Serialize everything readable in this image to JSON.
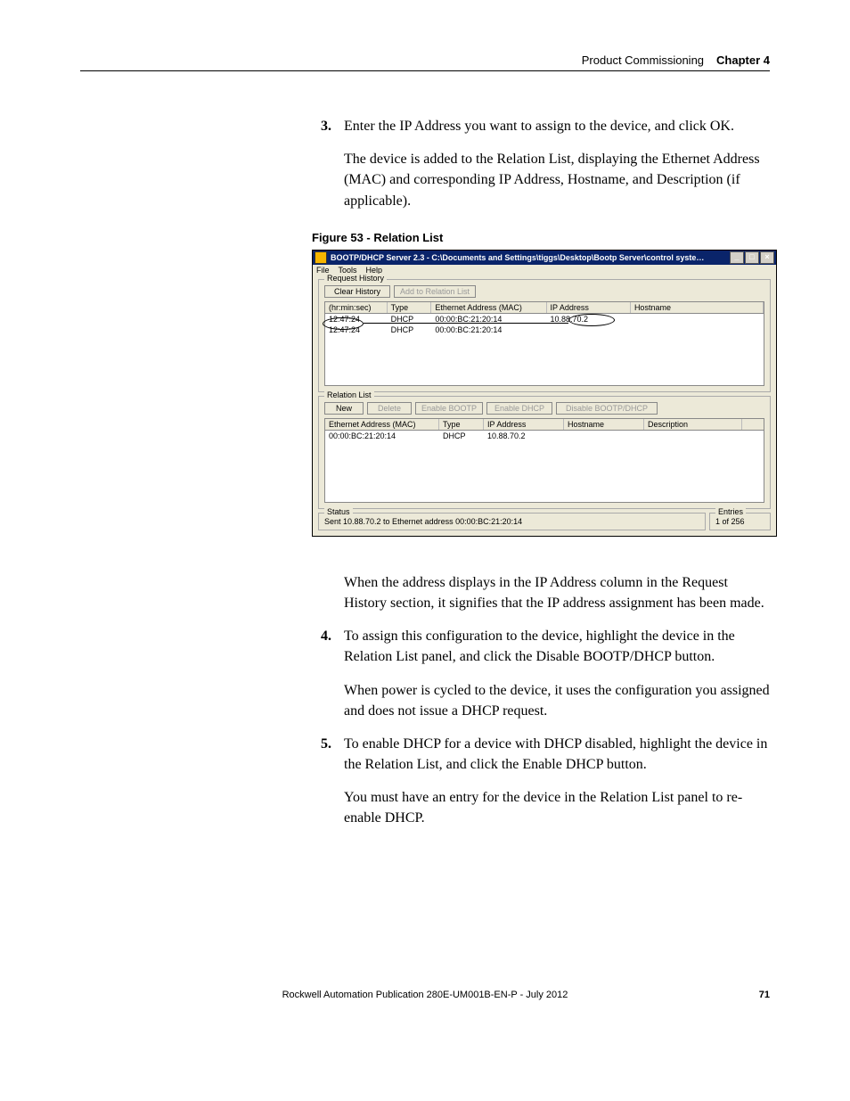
{
  "header": {
    "section": "Product Commissioning",
    "chapter": "Chapter 4"
  },
  "step3": {
    "num": "3.",
    "text": "Enter the IP Address you want to assign to the device, and click OK.",
    "para": "The device is added to the Relation List, displaying the Ethernet Address (MAC) and corresponding IP Address, Hostname, and Description (if applicable)."
  },
  "figure_caption": "Figure 53 - Relation List",
  "win": {
    "title": "BOOTP/DHCP Server 2.3 - C:\\Documents and Settings\\tiggs\\Desktop\\Bootp Server\\control syste…",
    "menus": [
      "File",
      "Tools",
      "Help"
    ],
    "request_history": {
      "label": "Request History",
      "buttons": {
        "clear": "Clear History",
        "add": "Add to Relation List"
      },
      "headers": [
        "(hr:min:sec)",
        "Type",
        "Ethernet Address (MAC)",
        "IP Address",
        "Hostname"
      ],
      "rows": [
        {
          "time": "12:47:24",
          "type": "DHCP",
          "mac": "00:00:BC:21:20:14",
          "ip": "10.88.70.2",
          "host": ""
        },
        {
          "time": "12:47:24",
          "type": "DHCP",
          "mac": "00:00:BC:21:20:14",
          "ip": "",
          "host": ""
        }
      ]
    },
    "relation_list": {
      "label": "Relation List",
      "buttons": {
        "new": "New",
        "delete": "Delete",
        "enable_bootp": "Enable BOOTP",
        "enable_dhcp": "Enable DHCP",
        "disable": "Disable BOOTP/DHCP"
      },
      "headers": [
        "Ethernet Address (MAC)",
        "Type",
        "IP Address",
        "Hostname",
        "Description"
      ],
      "rows": [
        {
          "mac": "00:00:BC:21:20:14",
          "type": "DHCP",
          "ip": "10.88.70.2",
          "host": "",
          "desc": ""
        }
      ]
    },
    "status": {
      "label": "Status",
      "text": "Sent 10.88.70.2 to Ethernet address 00:00:BC:21:20:14"
    },
    "entries": {
      "label": "Entries",
      "text": "1 of 256"
    },
    "win_btns": {
      "min": "_",
      "max": "□",
      "close": "×"
    }
  },
  "after_figure_para": "When the address displays in the IP Address column in the Request History section, it signifies that the IP address assignment has been made.",
  "step4": {
    "num": "4.",
    "text": "To assign this configuration to the device, highlight the device in the Relation List panel, and click the Disable BOOTP/DHCP button.",
    "para": "When power is cycled to the device, it  uses the configuration you assigned and does not issue a DHCP request."
  },
  "step5": {
    "num": "5.",
    "text": "To enable DHCP for a device with DHCP disabled, highlight the device in the Relation List, and click the Enable DHCP button.",
    "para": "You must have an entry for the device in the Relation List panel to re-enable DHCP."
  },
  "footer": {
    "pub": "Rockwell Automation Publication 280E-UM001B-EN-P - July 2012",
    "page": "71"
  }
}
